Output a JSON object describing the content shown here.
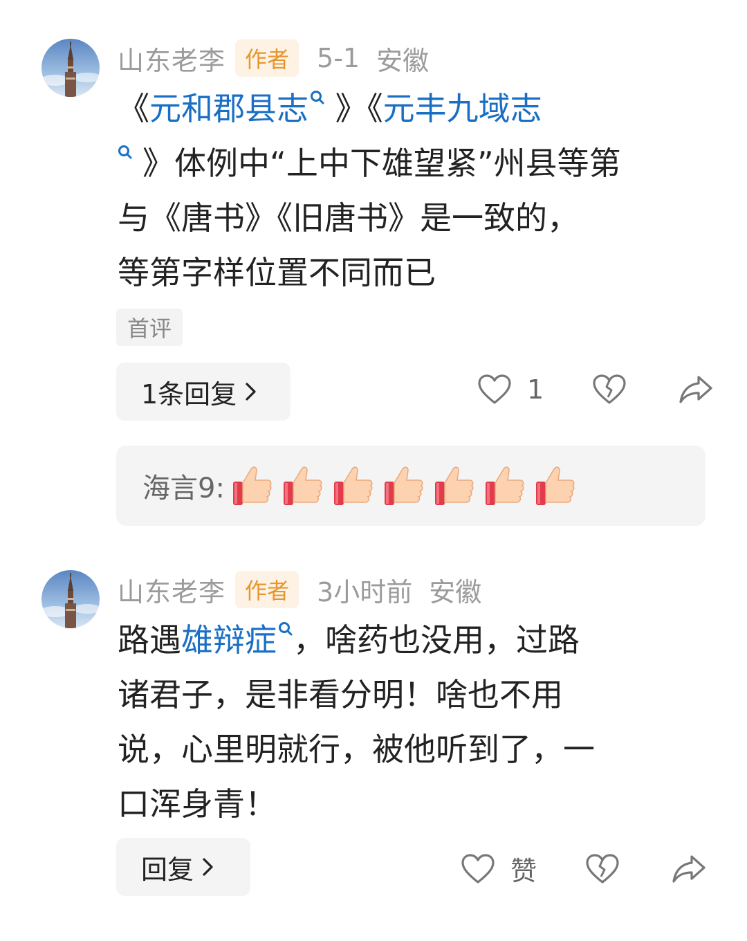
{
  "comments": [
    {
      "author": "山东老李",
      "badge": "作者",
      "time": "5-1",
      "location": "安徽",
      "lines": [
        {
          "a": "《",
          "link": "元和郡县志",
          "b": " 》《",
          "link2": "元丰九域志",
          "c": ""
        },
        {
          "pre": "",
          "b": "》体例中“上中下雄望紧”州县等第"
        },
        {
          "b": "与《唐书》《旧唐书》是一致的，"
        },
        {
          "b": "等第字样位置不同而已"
        }
      ],
      "tag": "首评",
      "reply_label": "1条回复",
      "like_count": "1",
      "sub_reply": {
        "name": "海言9:",
        "emoji": [
          "thumbs-up",
          "thumbs-up",
          "thumbs-up",
          "thumbs-up",
          "thumbs-up",
          "thumbs-up",
          "thumbs-up"
        ]
      }
    },
    {
      "author": "山东老李",
      "badge": "作者",
      "time": "3小时前",
      "location": "安徽",
      "lines": [
        {
          "a": "路遇",
          "link": "雄辩症",
          "b": "，啥药也没用，过路"
        },
        {
          "b": "诸君子，是非看分明！啥也不用"
        },
        {
          "b": "说，心里明就行，被他听到了，一"
        },
        {
          "b": "口浑身青！"
        }
      ],
      "reply_label": "回复",
      "like_label": "赞"
    }
  ],
  "colors": {
    "link": "#1a6fc4",
    "badge_text": "#e6962e",
    "badge_bg": "#fdf2e3",
    "meta_text": "#9b9b9b"
  },
  "icons": [
    "search-icon",
    "heart-icon",
    "broken-heart-icon",
    "share-icon",
    "chevron-right-icon",
    "thumbs-up-icon"
  ]
}
